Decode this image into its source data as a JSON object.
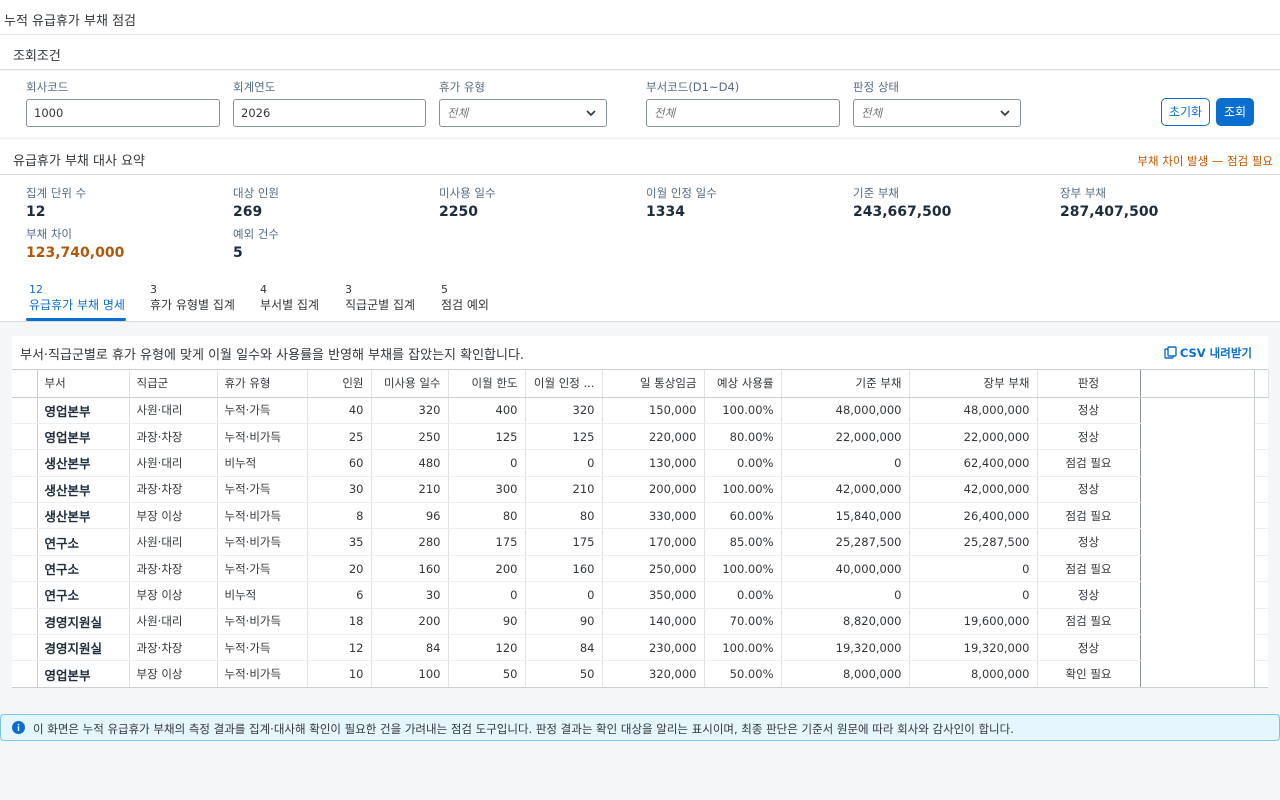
{
  "app": {
    "title": "누적 유급휴가 부채 점검"
  },
  "filters": {
    "section_title": "조회조건",
    "company_code": {
      "label": "회사코드",
      "value": "1000"
    },
    "fiscal_year": {
      "label": "회계연도",
      "value": "2026"
    },
    "leave_type": {
      "label": "휴가 유형",
      "placeholder": "전체"
    },
    "dept_code": {
      "label": "부서코드(D1~D4)",
      "placeholder": "전체"
    },
    "status": {
      "label": "판정 상태",
      "placeholder": "전체"
    },
    "reset_label": "초기화",
    "search_label": "조회"
  },
  "summary": {
    "section_title": "유급휴가 부채 대사 요약",
    "warning": "부채 차이 발생 — 점검 필요",
    "kpis": [
      {
        "label": "집계 단위 수",
        "value": "12"
      },
      {
        "label": "대상 인원",
        "value": "269"
      },
      {
        "label": "미사용 일수",
        "value": "2250"
      },
      {
        "label": "이월 인정 일수",
        "value": "1334"
      },
      {
        "label": "기준 부채",
        "value": "243,667,500"
      },
      {
        "label": "장부 부채",
        "value": "287,407,500"
      },
      {
        "label": "부채 차이",
        "value": "123,740,000"
      },
      {
        "label": "예외 건수",
        "value": "5"
      }
    ]
  },
  "tabs": [
    {
      "count": "12",
      "label": "유급휴가 부채 명세"
    },
    {
      "count": "3",
      "label": "휴가 유형별 집계"
    },
    {
      "count": "4",
      "label": "부서별 집계"
    },
    {
      "count": "3",
      "label": "직급군별 집계"
    },
    {
      "count": "5",
      "label": "점검 예외"
    }
  ],
  "table": {
    "description": "부서·직급군별로 휴가 유형에 맞게 이월 일수와 사용률을 반영해 부채를 잡았는지 확인합니다.",
    "csv_label": "CSV 내려받기",
    "columns": [
      "부서",
      "직급군",
      "휴가 유형",
      "인원",
      "미사용 일수",
      "이월 한도",
      "이월 인정 ...",
      "일 통상임금",
      "예상 사용률",
      "기준 부채",
      "장부 부채",
      "판정"
    ],
    "rows": [
      [
        "영업본부",
        "사원·대리",
        "누적·가득",
        "40",
        "320",
        "400",
        "320",
        "150,000",
        "100.00%",
        "48,000,000",
        "48,000,000",
        "정상"
      ],
      [
        "영업본부",
        "과장·차장",
        "누적·비가득",
        "25",
        "250",
        "125",
        "125",
        "220,000",
        "80.00%",
        "22,000,000",
        "22,000,000",
        "정상"
      ],
      [
        "생산본부",
        "사원·대리",
        "비누적",
        "60",
        "480",
        "0",
        "0",
        "130,000",
        "0.00%",
        "0",
        "62,400,000",
        "점검 필요"
      ],
      [
        "생산본부",
        "과장·차장",
        "누적·가득",
        "30",
        "210",
        "300",
        "210",
        "200,000",
        "100.00%",
        "42,000,000",
        "42,000,000",
        "정상"
      ],
      [
        "생산본부",
        "부장 이상",
        "누적·비가득",
        "8",
        "96",
        "80",
        "80",
        "330,000",
        "60.00%",
        "15,840,000",
        "26,400,000",
        "점검 필요"
      ],
      [
        "연구소",
        "사원·대리",
        "누적·비가득",
        "35",
        "280",
        "175",
        "175",
        "170,000",
        "85.00%",
        "25,287,500",
        "25,287,500",
        "정상"
      ],
      [
        "연구소",
        "과장·차장",
        "누적·가득",
        "20",
        "160",
        "200",
        "160",
        "250,000",
        "100.00%",
        "40,000,000",
        "0",
        "점검 필요"
      ],
      [
        "연구소",
        "부장 이상",
        "비누적",
        "6",
        "30",
        "0",
        "0",
        "350,000",
        "0.00%",
        "0",
        "0",
        "정상"
      ],
      [
        "경영지원실",
        "사원·대리",
        "누적·비가득",
        "18",
        "200",
        "90",
        "90",
        "140,000",
        "70.00%",
        "8,820,000",
        "19,600,000",
        "점검 필요"
      ],
      [
        "경영지원실",
        "과장·차장",
        "누적·가득",
        "12",
        "84",
        "120",
        "84",
        "230,000",
        "100.00%",
        "19,320,000",
        "19,320,000",
        "정상"
      ],
      [
        "영업본부",
        "부장 이상",
        "누적·비가득",
        "10",
        "100",
        "50",
        "50",
        "320,000",
        "50.00%",
        "8,000,000",
        "8,000,000",
        "확인 필요"
      ]
    ]
  },
  "status_colors": {
    "정상": "#256f3a",
    "점검 필요": "#b3570c",
    "확인 필요": "#0a6ed1"
  },
  "footer": {
    "icon": "info-icon",
    "text": "이 화면은 누적 유급휴가 부채의 측정 결과를 집계·대사해 확인이 필요한 건을 가려내는 점검 도구입니다. 판정 결과는 확인 대상을 알리는 표시이며, 최종 판단은 기준서 원문에 따라 회사와 감사인이 합니다."
  }
}
